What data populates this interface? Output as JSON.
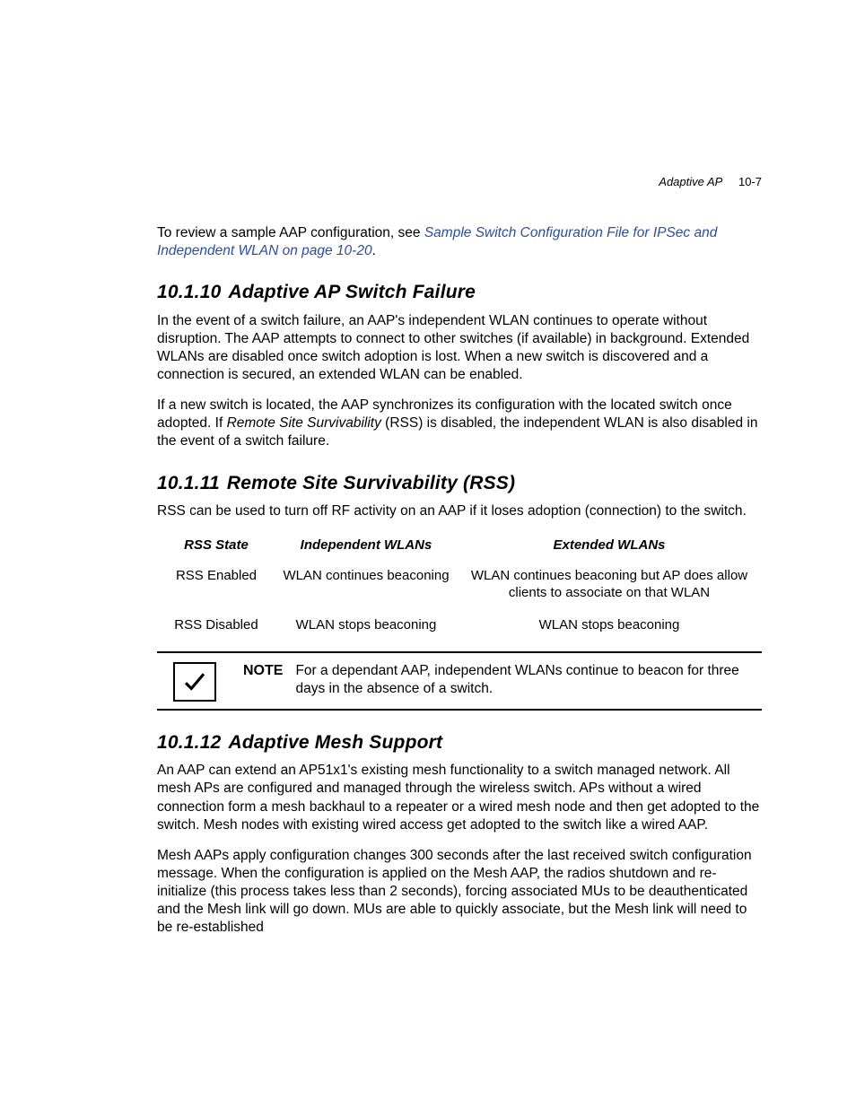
{
  "header": {
    "chapter": "Adaptive AP",
    "page_number": "10-7"
  },
  "intro": {
    "lead_in": "To review a sample AAP configuration, see ",
    "link_text": "Sample Switch Configuration File for IPSec and Independent WLAN on page 10-20",
    "period": "."
  },
  "sec_10_1_10": {
    "number": "10.1.10",
    "title": "Adaptive AP Switch Failure",
    "p1": "In the event of a switch failure, an AAP's independent WLAN continues to operate without disruption. The AAP attempts to connect to other switches (if available) in background. Extended WLANs are disabled once switch adoption is lost. When a new switch is discovered and a connection is secured, an extended WLAN can be enabled.",
    "p2_a": "If a new switch is located, the AAP synchronizes its configuration with the located switch once adopted. If ",
    "p2_term": "Remote Site Survivability",
    "p2_b": " (RSS) is disabled, the independent WLAN is also disabled in the event of a switch failure."
  },
  "sec_10_1_11": {
    "number": "10.1.11",
    "title": "Remote Site Survivability (RSS)",
    "p1": "RSS can be used to turn off RF activity on an AAP if it loses adoption (connection) to the switch.",
    "table": {
      "headers": [
        "RSS State",
        "Independent WLANs",
        "Extended WLANs"
      ],
      "rows": [
        [
          "RSS Enabled",
          "WLAN continues beaconing",
          "WLAN continues beaconing but AP does allow clients to associate on that WLAN"
        ],
        [
          "RSS Disabled",
          "WLAN stops beaconing",
          "WLAN stops beaconing"
        ]
      ]
    },
    "note_label": "NOTE",
    "note_text": "For a dependant AAP, independent WLANs continue to beacon for three days in the absence of a switch."
  },
  "sec_10_1_12": {
    "number": "10.1.12",
    "title": "Adaptive Mesh Support",
    "p1": "An AAP can extend an AP51x1's existing mesh functionality to a switch managed network. All mesh APs are configured and managed through the wireless switch. APs without a wired connection form a mesh backhaul to a repeater or a wired mesh node and then get adopted to the switch. Mesh nodes with existing wired access get adopted to the switch like a wired AAP.",
    "p2": "Mesh AAPs apply configuration changes 300 seconds after the last received switch configuration message. When the configuration is applied on the Mesh AAP, the radios shutdown and re-initialize (this process takes less than 2 seconds), forcing associated MUs to be deauthenticated and the Mesh link will go down. MUs are able to quickly associate, but the Mesh link will need to be re-established"
  }
}
